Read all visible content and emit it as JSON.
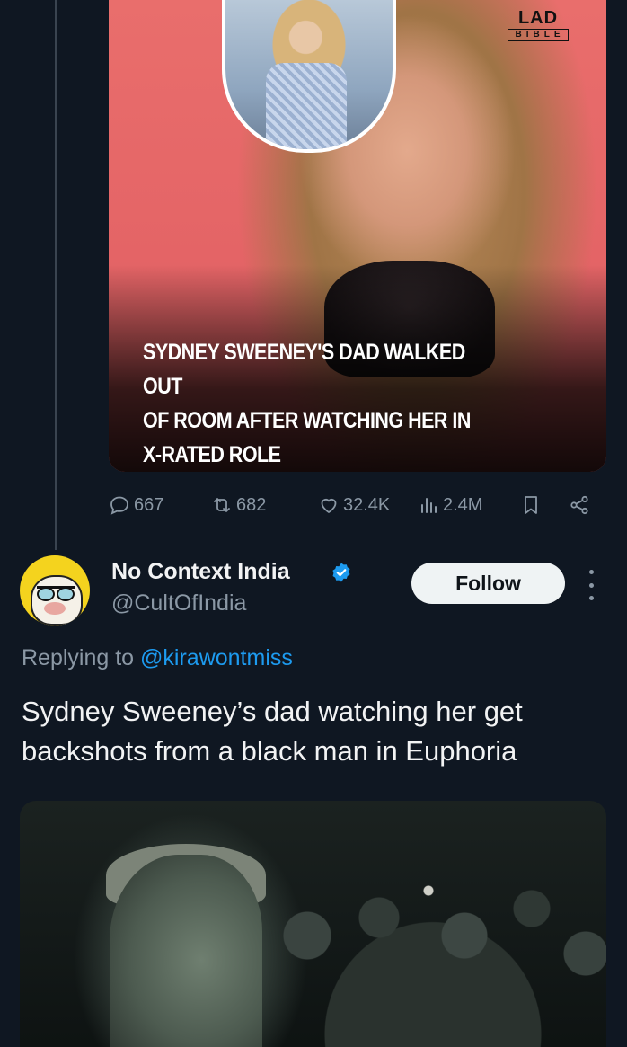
{
  "quoted_post": {
    "image": {
      "headline": "SYDNEY SWEENEY'S DAD WALKED OUT\nOF ROOM AFTER WATCHING HER IN\nX-RATED ROLE",
      "brand_top": "LAD",
      "brand_bottom": "BIBLE"
    },
    "actions": {
      "replies": "667",
      "reposts": "682",
      "likes": "32.4K",
      "views": "2.4M"
    }
  },
  "reply_post": {
    "display_name": "No Context India",
    "handle": "@CultOfIndia",
    "follow_label": "Follow",
    "replying_prefix": "Replying to",
    "replying_to": "@kirawontmiss",
    "text": "Sydney Sweeney’s dad watching her get\nbackshots from a black man in Euphoria"
  },
  "icons": {
    "reply": "comment-icon",
    "repost": "repost-icon",
    "like": "heart-icon",
    "views": "views-chart-icon",
    "bookmark": "bookmark-icon",
    "share": "share-icon",
    "verified": "verified-badge-icon",
    "more": "more-vertical-icon"
  },
  "colors": {
    "background": "#0f1722",
    "muted_text": "#8b98a5",
    "accent_blue": "#1d9bf0",
    "follow_button_bg": "#eff3f4"
  }
}
